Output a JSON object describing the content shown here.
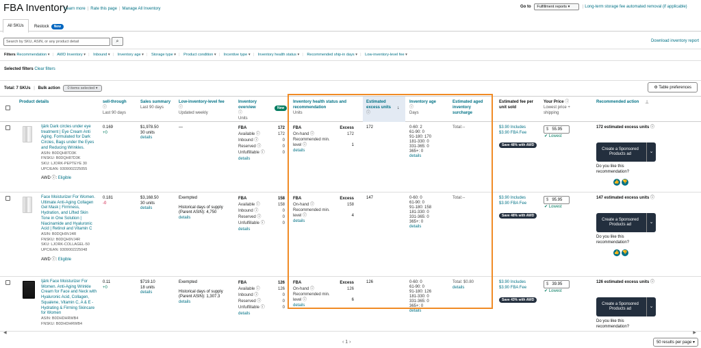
{
  "header": {
    "title": "FBA Inventory",
    "links": [
      "Learn more",
      "Rate this page",
      "Manage All Inventory"
    ],
    "goto_label": "Go to",
    "goto_select": "Fulfillment reports",
    "removal_link": "Long-term storage fee automated removal (if applicable)"
  },
  "tabs": [
    {
      "label": "All SKUs",
      "active": true
    },
    {
      "label": "Restock",
      "badge": "New"
    }
  ],
  "search": {
    "placeholder": "Search by SKU, ASIN, or any product detail",
    "download_link": "Download inventory report"
  },
  "filters": {
    "label": "Filters",
    "items": [
      "Recommendation",
      "AWD Inventory",
      "Inbound",
      "Inventory age",
      "Storage type",
      "Product condition",
      "Incentive type",
      "Inventory health status",
      "Recommended ship-in days",
      "Low-inventory-level fee"
    ],
    "selected_label": "Selected filters",
    "clear": "Clear filters"
  },
  "summary": {
    "total": "Total: 7 SKUs",
    "bulk": "Bulk action",
    "items_selected": "0 items selected",
    "table_pref": "Table preferences"
  },
  "columns": {
    "product": "Product details",
    "sell_through": "sell-through",
    "sell_through_sub": "Last 90 days",
    "sales": "Sales summary",
    "sales_sub": "Last 90 days",
    "lil_fee": "Low-inventory-level fee",
    "lil_fee_sub": "Updated weekly",
    "inv_overview": "Inventory overview",
    "inv_overview_sub": "Units",
    "inv_overview_badge": "New",
    "health": "Inventory health status and recommendation",
    "health_sub": "Units",
    "excess": "Estimated excess units",
    "age": "Inventory age",
    "age_sub": "Days",
    "aged": "Estimated aged inventory surcharge",
    "fee": "Estimated fee per unit sold",
    "price": "Your Price",
    "price_sub": "Lowest price + shipping",
    "rec": "Recommended action"
  },
  "rows": [
    {
      "title": "Ijärk Dark circles under eye treatment | Eye Cream Anti Aging. Formulated for Dark Circles, Bags under the Eyes and Reducing Wrinkles.",
      "asin": "ASIN: B0DQH87D3K",
      "fnsku": "FNSKU: B0DQH87D3K",
      "sku": "SKU: LJORK-PEPTEYE 30",
      "upc": "UPC/EAN: 9309002225055",
      "awd": "AWD",
      "awd_status": "Eligible",
      "sell": "0.169",
      "sell_delta": "+0",
      "sales_amt": "$1,978.50",
      "sales_units": "30 units",
      "details": "details",
      "lil": "—",
      "lil_hist": "",
      "fba": "FBA",
      "fba_total": "172",
      "available": "172",
      "inbound": "0",
      "reserved": "0",
      "unfulfillable": "0",
      "health_status": "Excess",
      "onhand": "172",
      "rec_min": "1",
      "excess": "172",
      "age": [
        "0-60: 2",
        "61-90: 0",
        "91-180: 170",
        "181-330: 0",
        "331-365: 0",
        "365+: 0"
      ],
      "aged_total": "Total:--",
      "aged_details": "",
      "fee1": "$3.90 Includes",
      "fee2": "$3.90 FBA Fee",
      "save": "Save 48% with AWD",
      "price": "55.95",
      "lowest": "Lowest",
      "rec_text": "172 estimated excess units",
      "sp": "Create a Sponsored Products ad",
      "like": "Do you like this recommendation?"
    },
    {
      "title": "Face Moisturizer For Women. Ultimate Anti-Aging Collagen Gel Mask | Firmness, Hydration, and Lifted Skin Tone in One Solution | Niacinamide and Hyaluronic Acid | Retinol and Vitamin C",
      "asin": "ASIN: B0DQH9VJ4R",
      "fnsku": "FNSKU: B0DQH9VJ4R",
      "sku": "SKU: LJORK-COLLAGEL-50",
      "upc": "UPC/EAN: 9309002225048",
      "awd": "AWD",
      "awd_status": "Eligible",
      "sell": "0.181",
      "sell_delta": "-0",
      "sales_amt": "$3,168.50",
      "sales_units": "30 units",
      "details": "details",
      "lil": "Exempted",
      "lil_hist": "Historical days of supply (Parent ASIN): 4,750",
      "fba": "FBA",
      "fba_total": "158",
      "available": "158",
      "inbound": "0",
      "reserved": "0",
      "unfulfillable": "0",
      "health_status": "Excess",
      "onhand": "158",
      "rec_min": "4",
      "excess": "147",
      "age": [
        "0-60: 0",
        "61-90: 0",
        "91-180: 158",
        "181-330: 0",
        "331-365: 0",
        "365+: 0"
      ],
      "aged_total": "Total:--",
      "aged_details": "",
      "fee1": "$3.90 Includes",
      "fee2": "$3.90 FBA Fee",
      "save": "Save 48% with AWD",
      "price": "95.95",
      "lowest": "Lowest",
      "rec_text": "147 estimated excess units",
      "sp": "Create a Sponsored Products ad",
      "like": "Do you like this recommendation?"
    },
    {
      "title": "Ijärk Face Moisturizer For Women. Anti-Aging Wrinkle Cream for Face and Neck with Hyaluronic Acid, Collagen, Squalene, Vitamin C, A & E - Hydrating & Firming Skincare for Women",
      "asin": "ASIN: B0DHDHRWB4",
      "fnsku": "FNSKU: B0DHDHRWB4",
      "sell": "0.11",
      "sell_delta": "+0",
      "sales_amt": "$719.10",
      "sales_units": "18 units",
      "details": "details",
      "lil": "Exempted",
      "lil_hist": "Historical days of supply (Parent ASIN): 1,307.3",
      "fba": "FBA",
      "fba_total": "126",
      "available": "126",
      "inbound": "0",
      "reserved": "0",
      "unfulfillable": "0",
      "health_status": "Excess",
      "onhand": "126",
      "rec_min": "6",
      "excess": "126",
      "age": [
        "0-60: 0",
        "61-90: 0",
        "91-180: 126",
        "181-330: 0",
        "331-365: 0",
        "365+: 0"
      ],
      "aged_total": "Total: $0.80",
      "aged_details": "details",
      "fee1": "$3.90 Includes",
      "fee2": "$3.90 FBA Fee",
      "save": "Save 43% with AWD",
      "price": "39.95",
      "lowest": "Lowest",
      "rec_text": "126 estimated excess units",
      "sp": "Create a Sponsored Products ad",
      "like": "Do you like this recommendation?"
    }
  ],
  "labels": {
    "available": "Available",
    "inbound": "Inbound",
    "reserved": "Reserved",
    "unfulfillable": "Unfulfillable",
    "onhand": "On-hand",
    "rec_min": "Recommended min. level",
    "details": "details"
  },
  "pager": {
    "text": "‹  1  ›",
    "per_page": "50 results per page"
  },
  "colors": {
    "accent": "#007185",
    "highlight_box": "#f08a24",
    "dark_button": "#232f3e"
  }
}
